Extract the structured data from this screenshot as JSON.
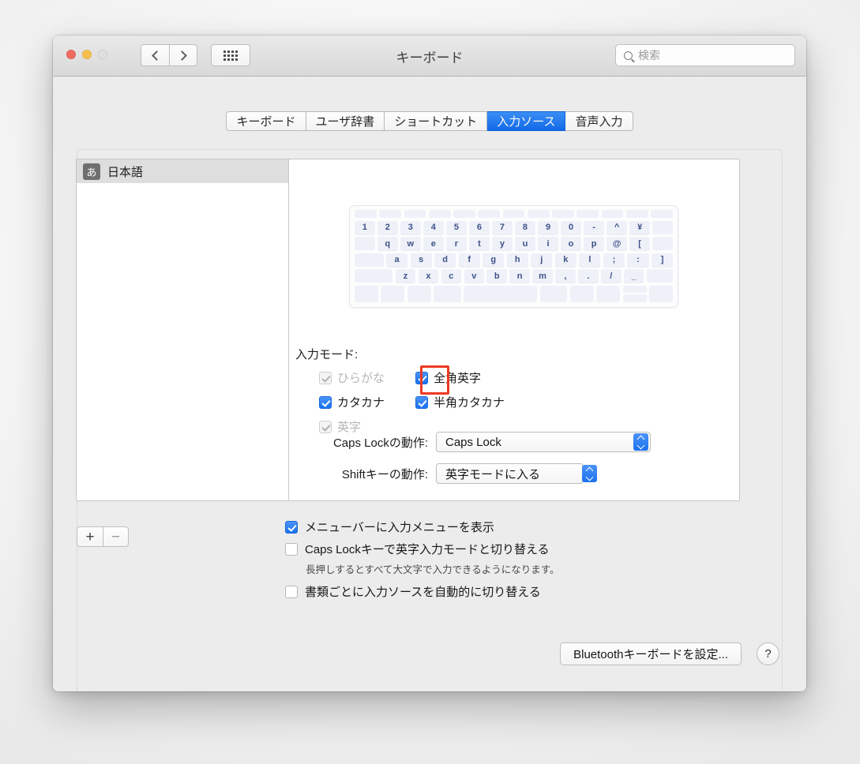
{
  "window": {
    "title": "キーボード",
    "traffic": {
      "close": "close-button",
      "minimize": "minimize-button",
      "zoom": "zoom-button"
    },
    "nav": {
      "back": "‹",
      "forward": "›",
      "grid": "show-all-grid"
    }
  },
  "search": {
    "placeholder": "検索",
    "value": ""
  },
  "tabs": [
    {
      "label": "キーボード",
      "active": false
    },
    {
      "label": "ユーザ辞書",
      "active": false
    },
    {
      "label": "ショートカット",
      "active": false
    },
    {
      "label": "入力ソース",
      "active": true
    },
    {
      "label": "音声入力",
      "active": false
    }
  ],
  "sidebar": {
    "items": [
      {
        "badge": "あ",
        "label": "日本語",
        "selected": true
      }
    ],
    "add_label": "+",
    "remove_label": "−"
  },
  "keyboard_preview": {
    "rows": [
      {
        "type": "function",
        "keys": [
          "",
          "",
          "",
          "",
          "",
          "",
          "",
          "",
          "",
          "",
          "",
          "",
          ""
        ]
      },
      {
        "type": "number",
        "keys": [
          "1",
          "2",
          "3",
          "4",
          "5",
          "6",
          "7",
          "8",
          "9",
          "0",
          "-",
          "^",
          "¥"
        ]
      },
      {
        "type": "letters",
        "keys": [
          "q",
          "w",
          "e",
          "r",
          "t",
          "y",
          "u",
          "i",
          "o",
          "p",
          "@",
          "["
        ]
      },
      {
        "type": "letters",
        "keys": [
          "a",
          "s",
          "d",
          "f",
          "g",
          "h",
          "j",
          "k",
          "l",
          ";",
          ":",
          "]"
        ]
      },
      {
        "type": "letters",
        "keys": [
          "z",
          "x",
          "c",
          "v",
          "b",
          "n",
          "m",
          ",",
          ".",
          "/",
          "_"
        ]
      },
      {
        "type": "modifier",
        "keys": [
          "",
          "",
          "",
          "",
          "",
          "",
          "",
          "",
          "",
          "",
          "",
          ""
        ]
      }
    ]
  },
  "input_mode": {
    "title": "入力モード:",
    "options": [
      {
        "label": "ひらがな",
        "checked": true,
        "enabled": false,
        "highlighted": false
      },
      {
        "label": "全角英字",
        "checked": true,
        "enabled": true,
        "highlighted": false
      },
      {
        "label": "カタカナ",
        "checked": true,
        "enabled": true,
        "highlighted": false
      },
      {
        "label": "半角カタカナ",
        "checked": true,
        "enabled": true,
        "highlighted": true
      },
      {
        "label": "英字",
        "checked": true,
        "enabled": false,
        "highlighted": false
      }
    ]
  },
  "caps_lock_row": {
    "label": "Caps Lockの動作:",
    "value": "Caps Lock"
  },
  "shift_row": {
    "label": "Shiftキーの動作:",
    "value": "英字モードに入る"
  },
  "bottom_options": [
    {
      "label": "メニューバーに入力メニューを表示",
      "checked": true
    },
    {
      "label": "Caps Lockキーで英字入力モードと切り替える",
      "checked": false
    },
    {
      "label": "書類ごとに入力ソースを自動的に切り替える",
      "checked": false
    }
  ],
  "bottom_note": "長押しするとすべて大文字で入力できるようになります。",
  "footer": {
    "bluetooth_label": "Bluetoothキーボードを設定...",
    "help_label": "?"
  },
  "colors": {
    "accent_blue": "#1a72ef",
    "highlight_red": "#ed3a23",
    "key_text": "#3f5289",
    "window_bg": "#ececec"
  }
}
